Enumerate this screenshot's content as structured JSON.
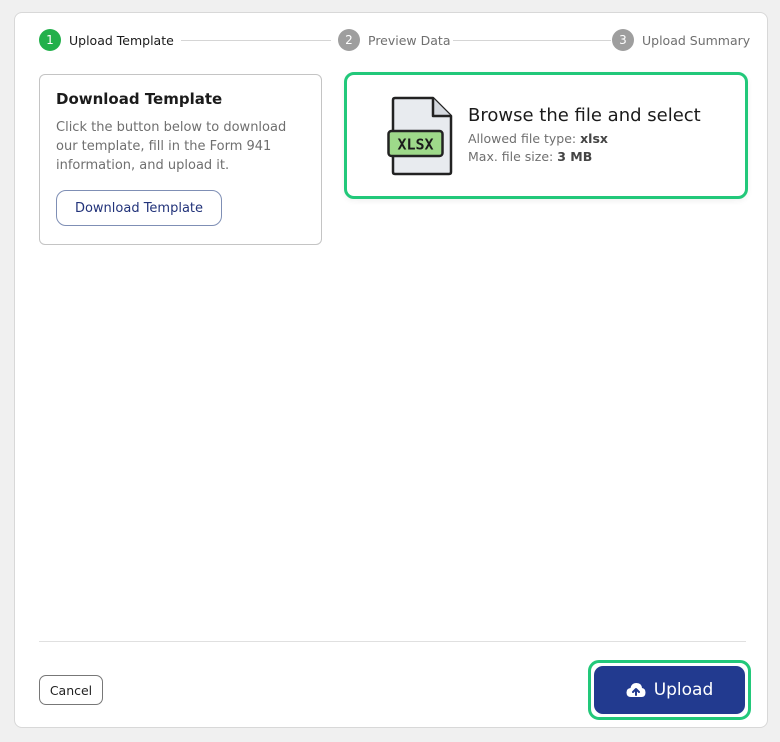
{
  "stepper": {
    "steps": [
      {
        "number": "1",
        "label": "Upload Template",
        "state": "active"
      },
      {
        "number": "2",
        "label": "Preview Data",
        "state": "inactive"
      },
      {
        "number": "3",
        "label": "Upload Summary",
        "state": "inactive"
      }
    ]
  },
  "download_card": {
    "title": "Download Template",
    "description": "Click the button below to download our template, fill in the Form 941 information, and upload it.",
    "button_label": "Download Template"
  },
  "browse": {
    "icon": "xlsx-file-icon",
    "icon_text": "XLSX",
    "title": "Browse the file and select",
    "allowed_label": "Allowed file type: ",
    "allowed_value": "xlsx",
    "max_label": "Max. file size: ",
    "max_value": "3 MB"
  },
  "footer": {
    "cancel_label": "Cancel",
    "upload_label": "Upload",
    "upload_icon": "cloud-upload-icon"
  },
  "colors": {
    "active_step": "#22b04b",
    "inactive_step": "#9e9e9e",
    "highlight": "#22c87a",
    "primary": "#223a8f"
  }
}
